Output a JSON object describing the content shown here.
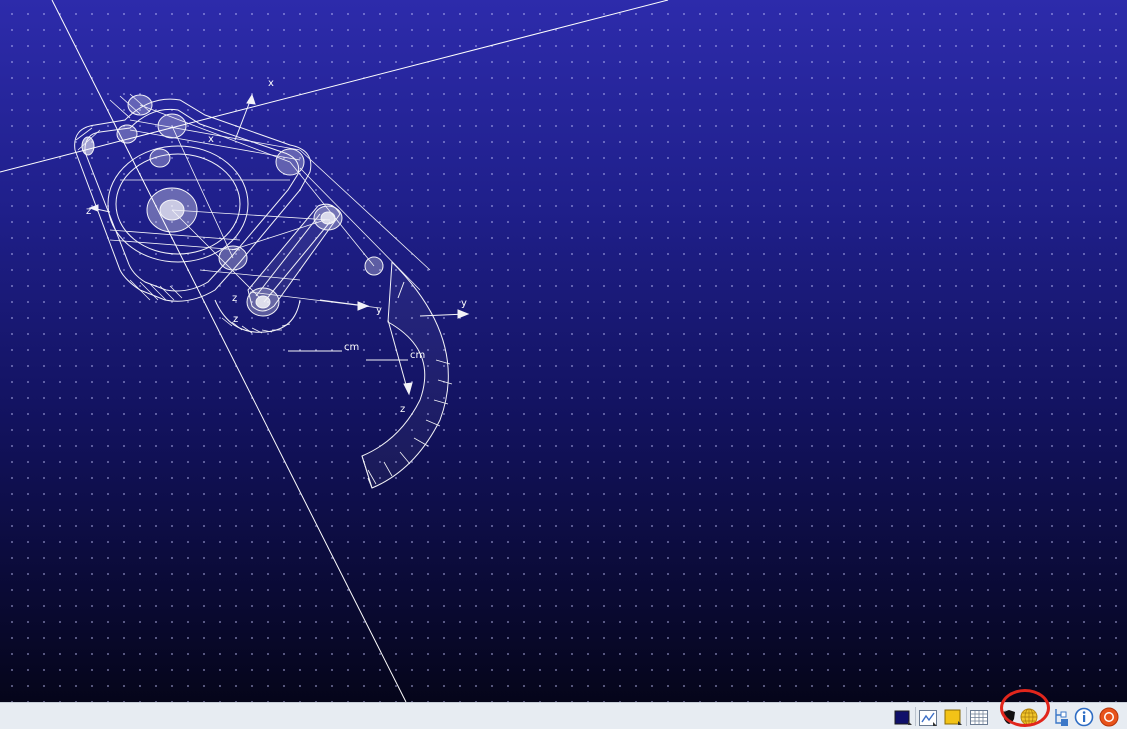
{
  "viewport": {
    "background_top": "#2d2bab",
    "background_bottom": "#05051a",
    "wireframe_color": "#ffffff",
    "axis_labels": {
      "x1": "x",
      "z1": "z",
      "x2": "x",
      "z2": "z",
      "z3": "z",
      "y1": "y",
      "y2": "y",
      "z4": "z"
    },
    "scale_units": {
      "cm1": "cm",
      "cm2": "cm"
    }
  },
  "statusbar": {
    "tools": [
      {
        "name": "background-color-icon"
      },
      {
        "name": "graph-view-icon"
      },
      {
        "name": "yellow-folder-icon"
      },
      {
        "name": "grid-table-icon"
      },
      {
        "name": "shield-icon"
      },
      {
        "name": "globe-icon"
      },
      {
        "name": "tree-structure-icon"
      },
      {
        "name": "info-icon"
      },
      {
        "name": "record-stop-icon"
      }
    ],
    "highlight_color": "#e1261c"
  }
}
